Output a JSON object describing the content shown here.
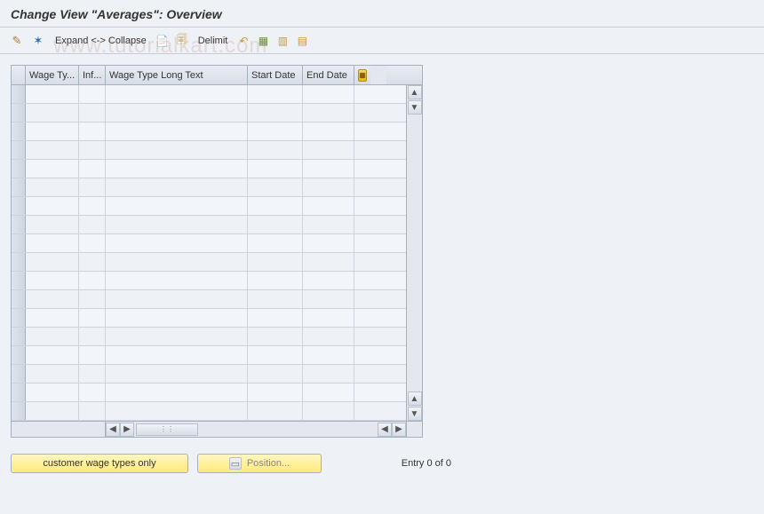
{
  "title": "Change View \"Averages\": Overview",
  "toolbar": {
    "expand_collapse": "Expand <-> Collapse",
    "delimit": "Delimit"
  },
  "table": {
    "columns": {
      "wage_type": "Wage Ty...",
      "inf": "Inf...",
      "long_text": "Wage Type Long Text",
      "start_date": "Start Date",
      "end_date": "End Date"
    }
  },
  "buttons": {
    "customer": "customer wage types only",
    "position": "Position..."
  },
  "status": {
    "entry": "Entry 0 of 0"
  },
  "watermark": "www.tutorialkart.com"
}
